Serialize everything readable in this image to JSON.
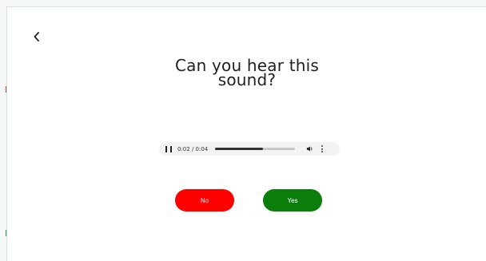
{
  "colors": {
    "no_button": "#ff0000",
    "yes_button": "#0b7d0b",
    "player_bg": "#f1f3f4",
    "text": "#1f1f1f"
  },
  "nav": {
    "back_icon": "chevron-left-icon"
  },
  "question": {
    "line1": "Can you hear this",
    "line2": "sound?"
  },
  "player": {
    "time": "0:02 / 0:04",
    "progress": 0.6,
    "play_state_icon": "pause-icon",
    "volume_icon": "volume-icon",
    "menu_icon": "more-vert-icon"
  },
  "answers": {
    "no_label": "No",
    "yes_label": "Yes"
  }
}
